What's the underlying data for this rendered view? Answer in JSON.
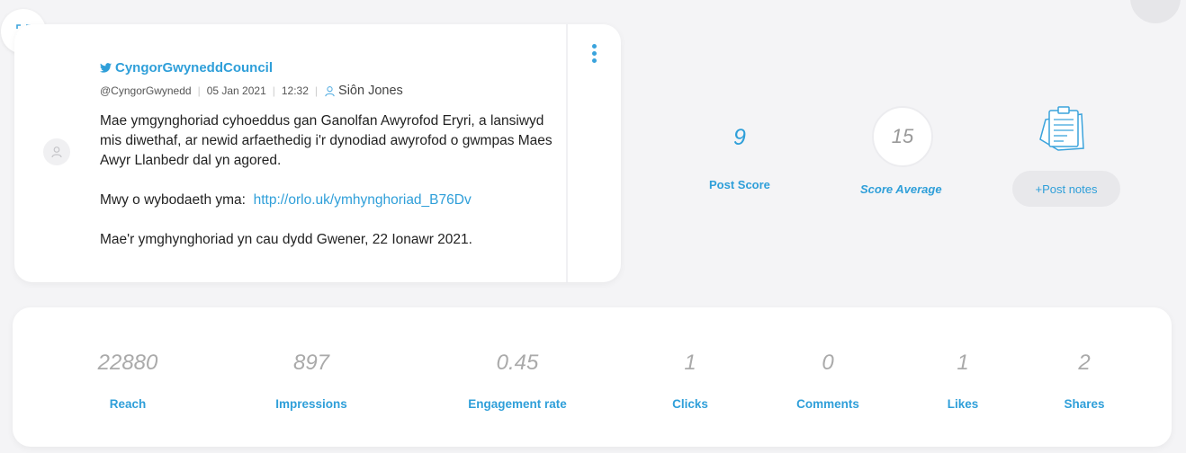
{
  "post": {
    "account_name": "CyngorGwyneddCouncil",
    "handle": "@CyngorGwynedd",
    "date": "05 Jan 2021",
    "time": "12:32",
    "author": "Siôn Jones",
    "body_paragraph_1": "Mae ymgynghoriad cyhoeddus gan Ganolfan Awyrofod Eryri, a lansiwyd mis diwethaf, ar newid arfaethedig i'r dynodiad awyrofod o gwmpas Maes Awyr Llanbedr dal yn agored.",
    "body_paragraph_2_prefix": "Mwy o wybodaeth yma:",
    "body_link": "http://orlo.uk/ymhynghoriad_B76Dv",
    "body_paragraph_3": "Mae'r ymghynghoriad yn cau dydd Gwener, 22 Ionawr 2021."
  },
  "scores": {
    "post_score_value": "9",
    "post_score_label": "Post Score",
    "score_average_value": "15",
    "score_average_label": "Score Average",
    "notes_button_label": "+Post notes"
  },
  "metrics": [
    {
      "value": "22880",
      "label": "Reach"
    },
    {
      "value": "897",
      "label": "Impressions"
    },
    {
      "value": "0.45",
      "label": "Engagement rate"
    },
    {
      "value": "1",
      "label": "Clicks"
    },
    {
      "value": "0",
      "label": "Comments"
    },
    {
      "value": "1",
      "label": "Likes"
    },
    {
      "value": "2",
      "label": "Shares"
    }
  ],
  "icons": {
    "expand": "expand-icon",
    "twitter": "twitter-icon",
    "user": "user-icon",
    "avatar": "avatar-placeholder-icon",
    "menu": "more-vertical-icon",
    "notes": "notes-icon"
  },
  "colors": {
    "accent": "#2f9fd9",
    "muted_value": "#aaaaaa",
    "background": "#f4f4f6"
  }
}
